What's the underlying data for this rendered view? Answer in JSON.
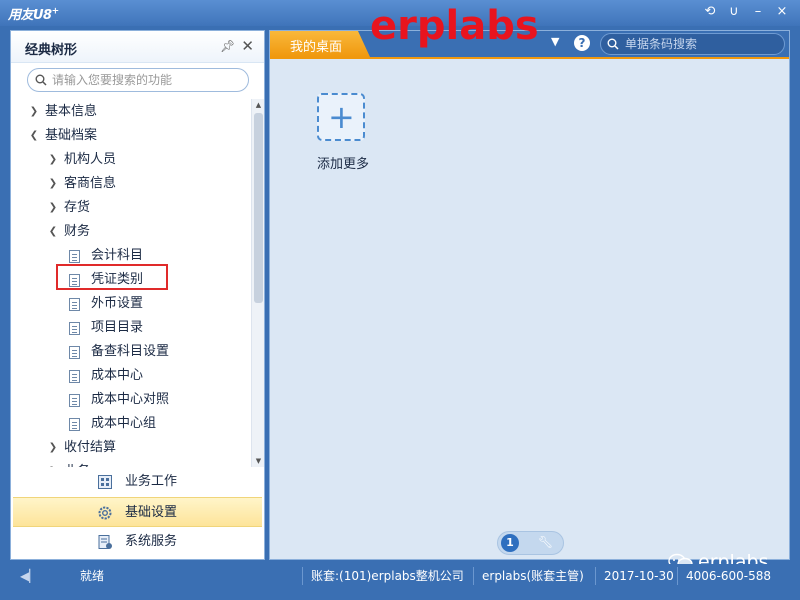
{
  "titlebar": {
    "app_name": "用友U8",
    "app_superscript": "+",
    "controls": [
      "refresh-icon",
      "undo-icon",
      "minimize-icon",
      "close-icon"
    ]
  },
  "left_panel": {
    "title": "经典树形",
    "search_placeholder": "请输入您要搜索的功能",
    "tree": [
      {
        "label": "基本信息",
        "level": 0,
        "expanded": false
      },
      {
        "label": "基础档案",
        "level": 0,
        "expanded": true
      },
      {
        "label": "机构人员",
        "level": 1,
        "expanded": false
      },
      {
        "label": "客商信息",
        "level": 1,
        "expanded": false
      },
      {
        "label": "存货",
        "level": 1,
        "expanded": false
      },
      {
        "label": "财务",
        "level": 1,
        "expanded": true
      },
      {
        "label": "会计科目",
        "level": 2,
        "leaf": true
      },
      {
        "label": "凭证类别",
        "level": 2,
        "leaf": true,
        "highlighted": true
      },
      {
        "label": "外币设置",
        "level": 2,
        "leaf": true
      },
      {
        "label": "项目目录",
        "level": 2,
        "leaf": true
      },
      {
        "label": "备查科目设置",
        "level": 2,
        "leaf": true
      },
      {
        "label": "成本中心",
        "level": 2,
        "leaf": true
      },
      {
        "label": "成本中心对照",
        "level": 2,
        "leaf": true
      },
      {
        "label": "成本中心组",
        "level": 2,
        "leaf": true
      },
      {
        "label": "收付结算",
        "level": 1,
        "expanded": false
      },
      {
        "label": "业务",
        "level": 1,
        "expanded": false
      }
    ],
    "nav": [
      {
        "label": "业务工作",
        "icon": "business-icon",
        "active": false
      },
      {
        "label": "基础设置",
        "icon": "gear-icon",
        "active": true
      },
      {
        "label": "系统服务",
        "icon": "service-icon",
        "active": false
      }
    ]
  },
  "right_panel": {
    "tab_label": "我的桌面",
    "search_placeholder": "单据条码搜索",
    "add_label": "添加更多",
    "page": "1"
  },
  "watermark": {
    "text": "erplabs",
    "color": "#e8141e"
  },
  "wechat_watermark": "erplabs",
  "statusbar": {
    "status": "就绪",
    "account": "账套:(101)erplabs整机公司",
    "user": "erplabs(账套主管)",
    "date": "2017-10-30",
    "phone": "4006-600-588"
  },
  "colors": {
    "accent": "#f0980e",
    "brand": "#3a6fb3",
    "highlight": "#e02a2a"
  }
}
